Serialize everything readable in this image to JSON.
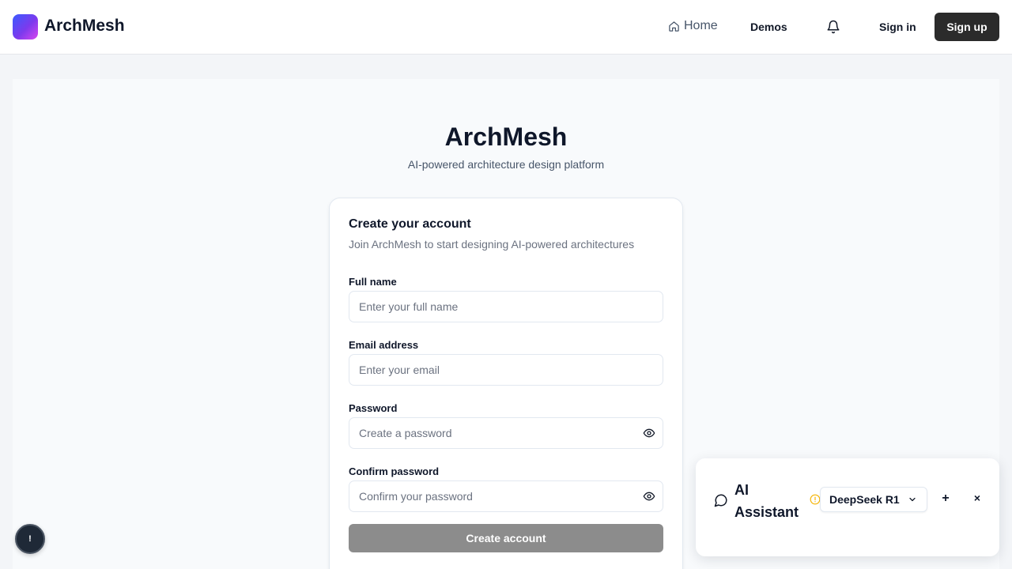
{
  "header": {
    "brand": "ArchMesh",
    "nav": {
      "home": "Home",
      "demos": "Demos",
      "sign_in": "Sign in",
      "sign_up": "Sign up"
    },
    "icons": {
      "logo": "gradient-logo",
      "home": "home-icon",
      "bell": "bell-icon"
    }
  },
  "hero": {
    "title": "ArchMesh",
    "subtitle": "AI-powered architecture design platform"
  },
  "signup_form": {
    "title": "Create your account",
    "subtitle": "Join ArchMesh to start designing AI-powered architectures",
    "fields": {
      "full_name": {
        "label": "Full name",
        "placeholder": "Enter your full name",
        "value": ""
      },
      "email": {
        "label": "Email address",
        "placeholder": "Enter your email",
        "value": ""
      },
      "password": {
        "label": "Password",
        "placeholder": "Create a password",
        "value": ""
      },
      "confirm_password": {
        "label": "Confirm password",
        "placeholder": "Confirm your password",
        "value": ""
      }
    },
    "submit_label": "Create account"
  },
  "help_button": {
    "label": "!"
  },
  "ai_assistant": {
    "title": "AI Assistant",
    "model": "DeepSeek R1",
    "new_label": "+",
    "close_label": "×",
    "icons": [
      "chat-icon",
      "warning-icon",
      "chevron-down-icon"
    ]
  },
  "colors": {
    "primary_button": "#2b2b2b",
    "disabled_button": "#8c8c8c",
    "warning": "#f5b301",
    "logo_gradient": [
      "#3b5bff",
      "#7c3aed",
      "#d946ef"
    ]
  }
}
